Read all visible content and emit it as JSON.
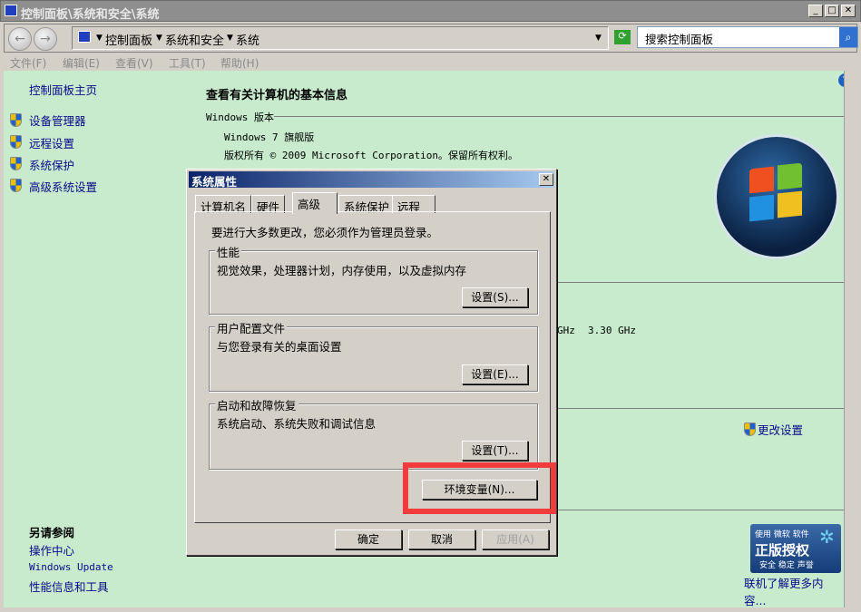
{
  "window": {
    "title": "控制面板\\系统和安全\\系统",
    "min": "_",
    "max": "□",
    "close": "✕"
  },
  "address": {
    "crumbs": [
      "控制面板",
      "系统和安全",
      "系统"
    ],
    "search_placeholder": "搜索控制面板"
  },
  "menu": [
    "文件(F)",
    "编辑(E)",
    "查看(V)",
    "工具(T)",
    "帮助(H)"
  ],
  "sidebar": {
    "home": "控制面板主页",
    "items": [
      "设备管理器",
      "远程设置",
      "系统保护",
      "高级系统设置"
    ],
    "see_also_title": "另请参阅",
    "see_also": [
      "操作中心",
      "Windows Update",
      "性能信息和工具"
    ]
  },
  "main": {
    "heading": "查看有关计算机的基本信息",
    "edition_section": "Windows 版本",
    "edition": "Windows 7 旗舰版",
    "copyright": "版权所有 © 2009 Microsoft Corporation。保留所有权利。",
    "cpu_fragment": "GHz",
    "cpu_speed": "3.30 GHz",
    "change_settings": "更改设置",
    "genuine": {
      "line1": "使用 微软 软件",
      "line2": "正版授权",
      "line3": "安全 稳定 声誉"
    },
    "learn_more": "联机了解更多内容..."
  },
  "dialog": {
    "title": "系统属性",
    "close": "✕",
    "tabs": [
      "计算机名",
      "硬件",
      "高级",
      "系统保护",
      "远程"
    ],
    "active_tab": "高级",
    "admin_note": "要进行大多数更改，您必须作为管理员登录。",
    "groups": [
      {
        "label": "性能",
        "desc": "视觉效果，处理器计划，内存使用，以及虚拟内存",
        "button": "设置(S)..."
      },
      {
        "label": "用户配置文件",
        "desc": "与您登录有关的桌面设置",
        "button": "设置(E)..."
      },
      {
        "label": "启动和故障恢复",
        "desc": "系统启动、系统失败和调试信息",
        "button": "设置(T)..."
      }
    ],
    "env_button": "环境变量(N)...",
    "ok": "确定",
    "cancel": "取消",
    "apply": "应用(A)"
  },
  "highlight_color": "#f03c3c"
}
